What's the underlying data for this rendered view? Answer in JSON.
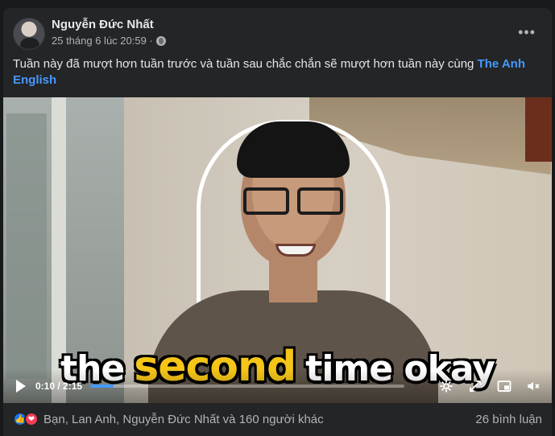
{
  "post": {
    "author": "Nguyễn Đức Nhất",
    "timestamp": "25 tháng 6 lúc 20:59 ·",
    "privacy_icon": "globe-icon",
    "more_label": "•••",
    "text": "Tuần này đã mượt hơn tuần trước và tuần sau chắc chắn sẽ mượt hơn tuần này cùng",
    "tag": "The Anh English"
  },
  "video": {
    "caption_1": "the",
    "caption_2": "second",
    "caption_3": "time okay",
    "time": "0:10 / 2:15",
    "progress": 0.074,
    "progress_color": "#4599ff",
    "icons": [
      "play-icon",
      "settings-icon",
      "expand-icon",
      "pip-icon",
      "mute-icon"
    ]
  },
  "footer": {
    "likes_text": "Bạn, Lan Anh, Nguyễn Đức Nhất và 160 người khác",
    "comments_text": "26 bình luận",
    "reactions": [
      "like-icon",
      "love-icon"
    ]
  }
}
